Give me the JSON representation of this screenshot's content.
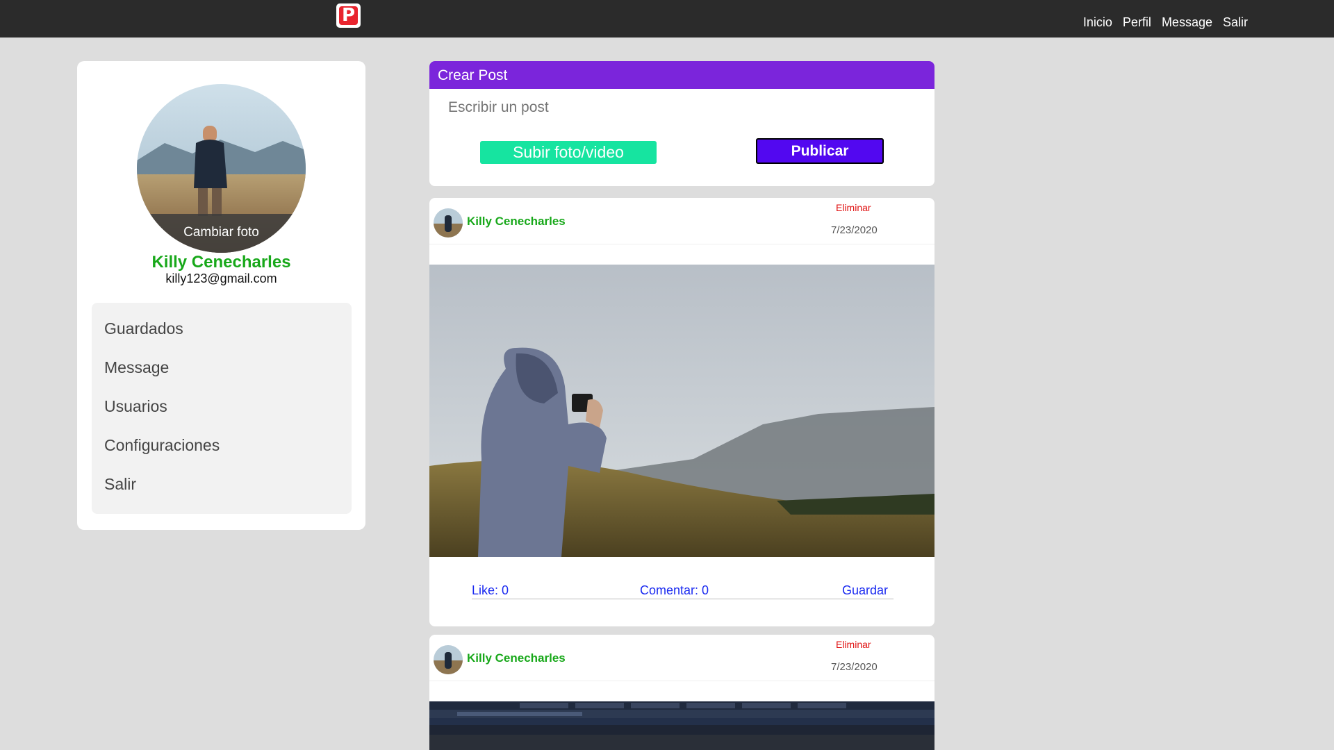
{
  "nav": {
    "items": [
      "Inicio",
      "Perfil",
      "Message",
      "Salir"
    ]
  },
  "logo": {
    "letter": "P"
  },
  "profile": {
    "change_photo": "Cambiar foto",
    "name": "Killy Cenecharles",
    "email": "killy123@gmail.com"
  },
  "menu": {
    "items": [
      "Guardados",
      "Message",
      "Usuarios",
      "Configuraciones",
      "Salir"
    ]
  },
  "create_post": {
    "title": "Crear Post",
    "placeholder": "Escribir un post",
    "upload_label": "Subir foto/video",
    "publish_label": "Publicar"
  },
  "posts": [
    {
      "author": "Killy Cenecharles",
      "delete_label": "Eliminar",
      "date": "7/23/2020",
      "like_label": "Like: 0",
      "comment_label": "Comentar: 0",
      "save_label": "Guardar"
    },
    {
      "author": "Killy Cenecharles",
      "delete_label": "Eliminar",
      "date": "7/23/2020"
    }
  ],
  "colors": {
    "topbar": "#2b2b2b",
    "create_header": "#7b25db",
    "upload_button": "#16e4a0",
    "publish_button": "#5208f0",
    "username": "#18a81a",
    "delete": "#e01010",
    "action_link": "#1a2af0"
  }
}
